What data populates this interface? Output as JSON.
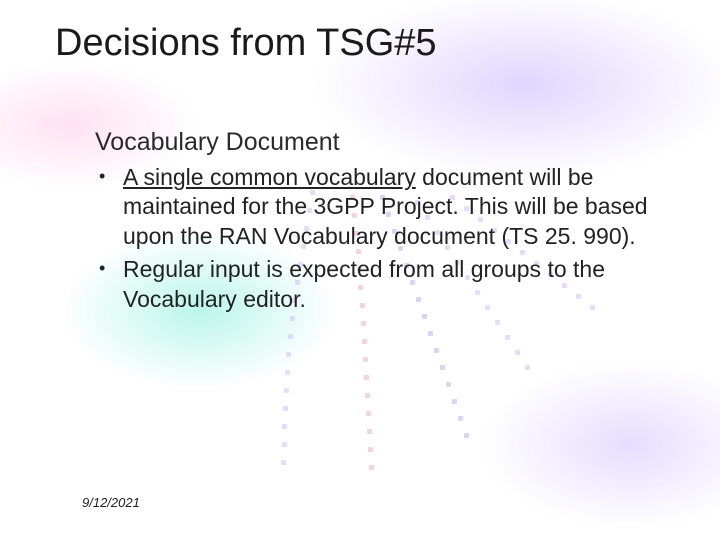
{
  "title": "Decisions from TSG#5",
  "subhead": "Vocabulary Document",
  "bullets": [
    {
      "underlined": "A single common vocabulary",
      "rest": " document will be maintained for the 3GPP Project. This will be based upon the RAN Vocabulary document (TS 25. 990)."
    },
    {
      "underlined": "",
      "rest": "Regular input is expected from all groups to the Vocabulary editor."
    }
  ],
  "date": "9/12/2021"
}
